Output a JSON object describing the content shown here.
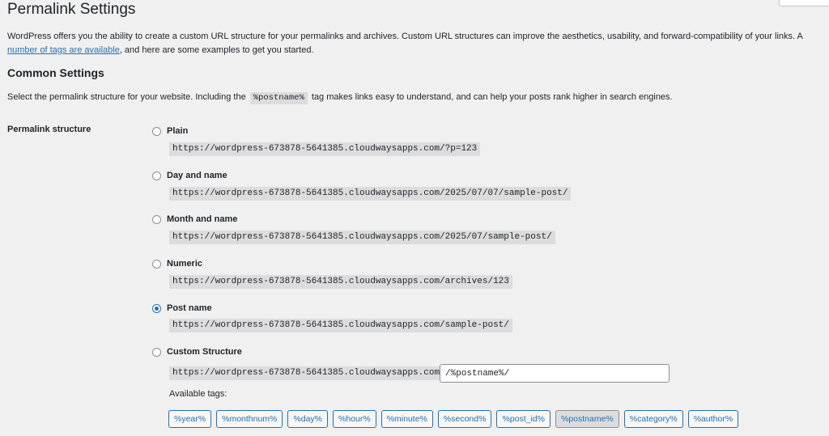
{
  "page": {
    "title": "Permalink Settings",
    "intro_before_link": "WordPress offers you the ability to create a custom URL structure for your permalinks and archives. Custom URL structures can improve the aesthetics, usability, and forward-compatibility of your links. A ",
    "intro_link": "number of tags are available",
    "intro_after_link": ", and here are some examples to get you started."
  },
  "common": {
    "title": "Common Settings",
    "desc_before": "Select the permalink structure for your website. Including the",
    "desc_tag": "%postname%",
    "desc_after": "tag makes links easy to understand, and can help your posts rank higher in search engines.",
    "field_label": "Permalink structure"
  },
  "options": [
    {
      "label": "Plain",
      "url": "https://wordpress-673878-5641385.cloudwaysapps.com/?p=123",
      "checked": false
    },
    {
      "label": "Day and name",
      "url": "https://wordpress-673878-5641385.cloudwaysapps.com/2025/07/07/sample-post/",
      "checked": false
    },
    {
      "label": "Month and name",
      "url": "https://wordpress-673878-5641385.cloudwaysapps.com/2025/07/sample-post/",
      "checked": false
    },
    {
      "label": "Numeric",
      "url": "https://wordpress-673878-5641385.cloudwaysapps.com/archives/123",
      "checked": false
    },
    {
      "label": "Post name",
      "url": "https://wordpress-673878-5641385.cloudwaysapps.com/sample-post/",
      "checked": true
    },
    {
      "label": "Custom Structure",
      "url": "https://wordpress-673878-5641385.cloudwaysapps.com",
      "checked": false
    }
  ],
  "custom": {
    "value": "/%postname%/",
    "available_label": "Available tags:"
  },
  "tags": [
    "%year%",
    "%monthnum%",
    "%day%",
    "%hour%",
    "%minute%",
    "%second%",
    "%post_id%",
    "%postname%",
    "%category%",
    "%author%"
  ],
  "active_tag": "%postname%",
  "colors": {
    "accent": "#2271b1",
    "background": "#f0f0f1",
    "code_bg": "#dcdcde"
  }
}
